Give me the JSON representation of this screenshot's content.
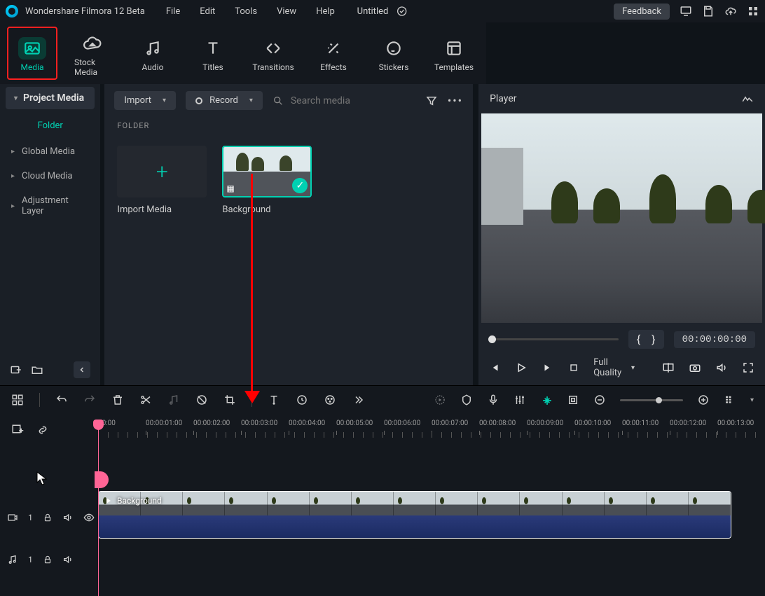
{
  "app": {
    "title": "Wondershare Filmora 12 Beta"
  },
  "menus": [
    "File",
    "Edit",
    "Tools",
    "View",
    "Help"
  ],
  "document": {
    "title": "Untitled"
  },
  "feedback": "Feedback",
  "tabs": {
    "media": "Media",
    "stock": "Stock Media",
    "audio": "Audio",
    "titles": "Titles",
    "transitions": "Transitions",
    "effects": "Effects",
    "stickers": "Stickers",
    "templates": "Templates"
  },
  "sidebar": {
    "project": "Project Media",
    "folder": "Folder",
    "global": "Global Media",
    "cloud": "Cloud Media",
    "adjustment": "Adjustment Layer"
  },
  "media_toolbar": {
    "import": "Import",
    "record": "Record",
    "search_placeholder": "Search media"
  },
  "folder_label": "FOLDER",
  "cards": {
    "import_media": "Import Media",
    "background": "Background"
  },
  "player": {
    "title": "Player",
    "quality": "Full Quality",
    "timecode": "00:00:00:00",
    "mark_in": "{",
    "mark_out": "}"
  },
  "timeline": {
    "ticks": [
      "00:00",
      "00:00:01:00",
      "00:00:02:00",
      "00:00:03:00",
      "00:00:04:00",
      "00:00:05:00",
      "00:00:06:00",
      "00:00:07:00",
      "00:00:08:00",
      "00:00:09:00",
      "00:00:10:00",
      "00:00:11:00",
      "00:00:12:00",
      "00:00:13:00"
    ],
    "clip_name": "Background",
    "video_track": "1",
    "audio_track": "1"
  }
}
